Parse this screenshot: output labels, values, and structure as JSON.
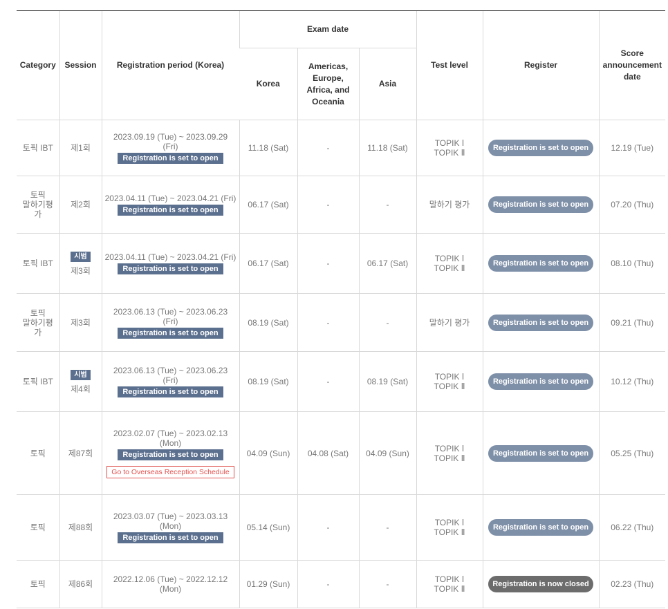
{
  "headers": {
    "category": "Category",
    "session": "Session",
    "registration_period": "Registration period (Korea)",
    "exam_date": "Exam date",
    "korea": "Korea",
    "americas": "Americas, Europe, Africa, and Oceania",
    "asia": "Asia",
    "test_level": "Test level",
    "register": "Register",
    "score_date": "Score announcement date"
  },
  "labels": {
    "set_to_open": "Registration is set to open",
    "now_closed": "Registration is now closed",
    "overseas": "Go to Overseas Reception Schedule",
    "pilot": "시범",
    "topik1": "TOPIK Ⅰ",
    "topik2": "TOPIK Ⅱ",
    "speaking": "말하기 평가"
  },
  "rows": [
    {
      "category": "토픽 IBT",
      "session": "제1회",
      "pilot": false,
      "period": "2023.09.19 (Tue) ~ 2023.09.29 (Fri)",
      "korea": "11.18 (Sat)",
      "americas": "-",
      "asia": "11.18 (Sat)",
      "level": "topik",
      "score": "12.19 (Tue)",
      "status": "open"
    },
    {
      "category": "토픽\n말하기평\n가",
      "session": "제2회",
      "pilot": false,
      "period": "2023.04.11 (Tue) ~ 2023.04.21 (Fri)",
      "korea": "06.17 (Sat)",
      "americas": "-",
      "asia": "-",
      "level": "speaking",
      "score": "07.20 (Thu)",
      "status": "open"
    },
    {
      "category": "토픽 IBT",
      "session": "제3회",
      "pilot": true,
      "period": "2023.04.11 (Tue) ~ 2023.04.21 (Fri)",
      "korea": "06.17 (Sat)",
      "americas": "-",
      "asia": "06.17 (Sat)",
      "level": "topik",
      "score": "08.10 (Thu)",
      "status": "open"
    },
    {
      "category": "토픽\n말하기평\n가",
      "session": "제3회",
      "pilot": false,
      "period": "2023.06.13 (Tue) ~ 2023.06.23 (Fri)",
      "korea": "08.19 (Sat)",
      "americas": "-",
      "asia": "-",
      "level": "speaking",
      "score": "09.21 (Thu)",
      "status": "open"
    },
    {
      "category": "토픽 IBT",
      "session": "제4회",
      "pilot": true,
      "period": "2023.06.13 (Tue) ~ 2023.06.23 (Fri)",
      "korea": "08.19 (Sat)",
      "americas": "-",
      "asia": "08.19 (Sat)",
      "level": "topik",
      "score": "10.12 (Thu)",
      "status": "open"
    },
    {
      "category": "토픽",
      "session": "제87회",
      "pilot": false,
      "period": "2023.02.07 (Tue) ~ 2023.02.13\n(Mon)",
      "korea": "04.09 (Sun)",
      "americas": "04.08 (Sat)",
      "asia": "04.09 (Sun)",
      "level": "topik",
      "score": "05.25 (Thu)",
      "status": "open",
      "overseas": true
    },
    {
      "category": "토픽",
      "session": "제88회",
      "pilot": false,
      "period": "2023.03.07 (Tue) ~ 2023.03.13\n(Mon)",
      "korea": "05.14 (Sun)",
      "americas": "-",
      "asia": "-",
      "level": "topik",
      "score": "06.22 (Thu)",
      "status": "open"
    },
    {
      "category": "토픽",
      "session": "제86회",
      "pilot": false,
      "period": "2022.12.06 (Tue) ~ 2022.12.12\n(Mon)",
      "korea": "01.29 (Sun)",
      "americas": "-",
      "asia": "-",
      "level": "topik",
      "score": "02.23 (Thu)",
      "status": "closed",
      "no_period_tag": true
    }
  ]
}
